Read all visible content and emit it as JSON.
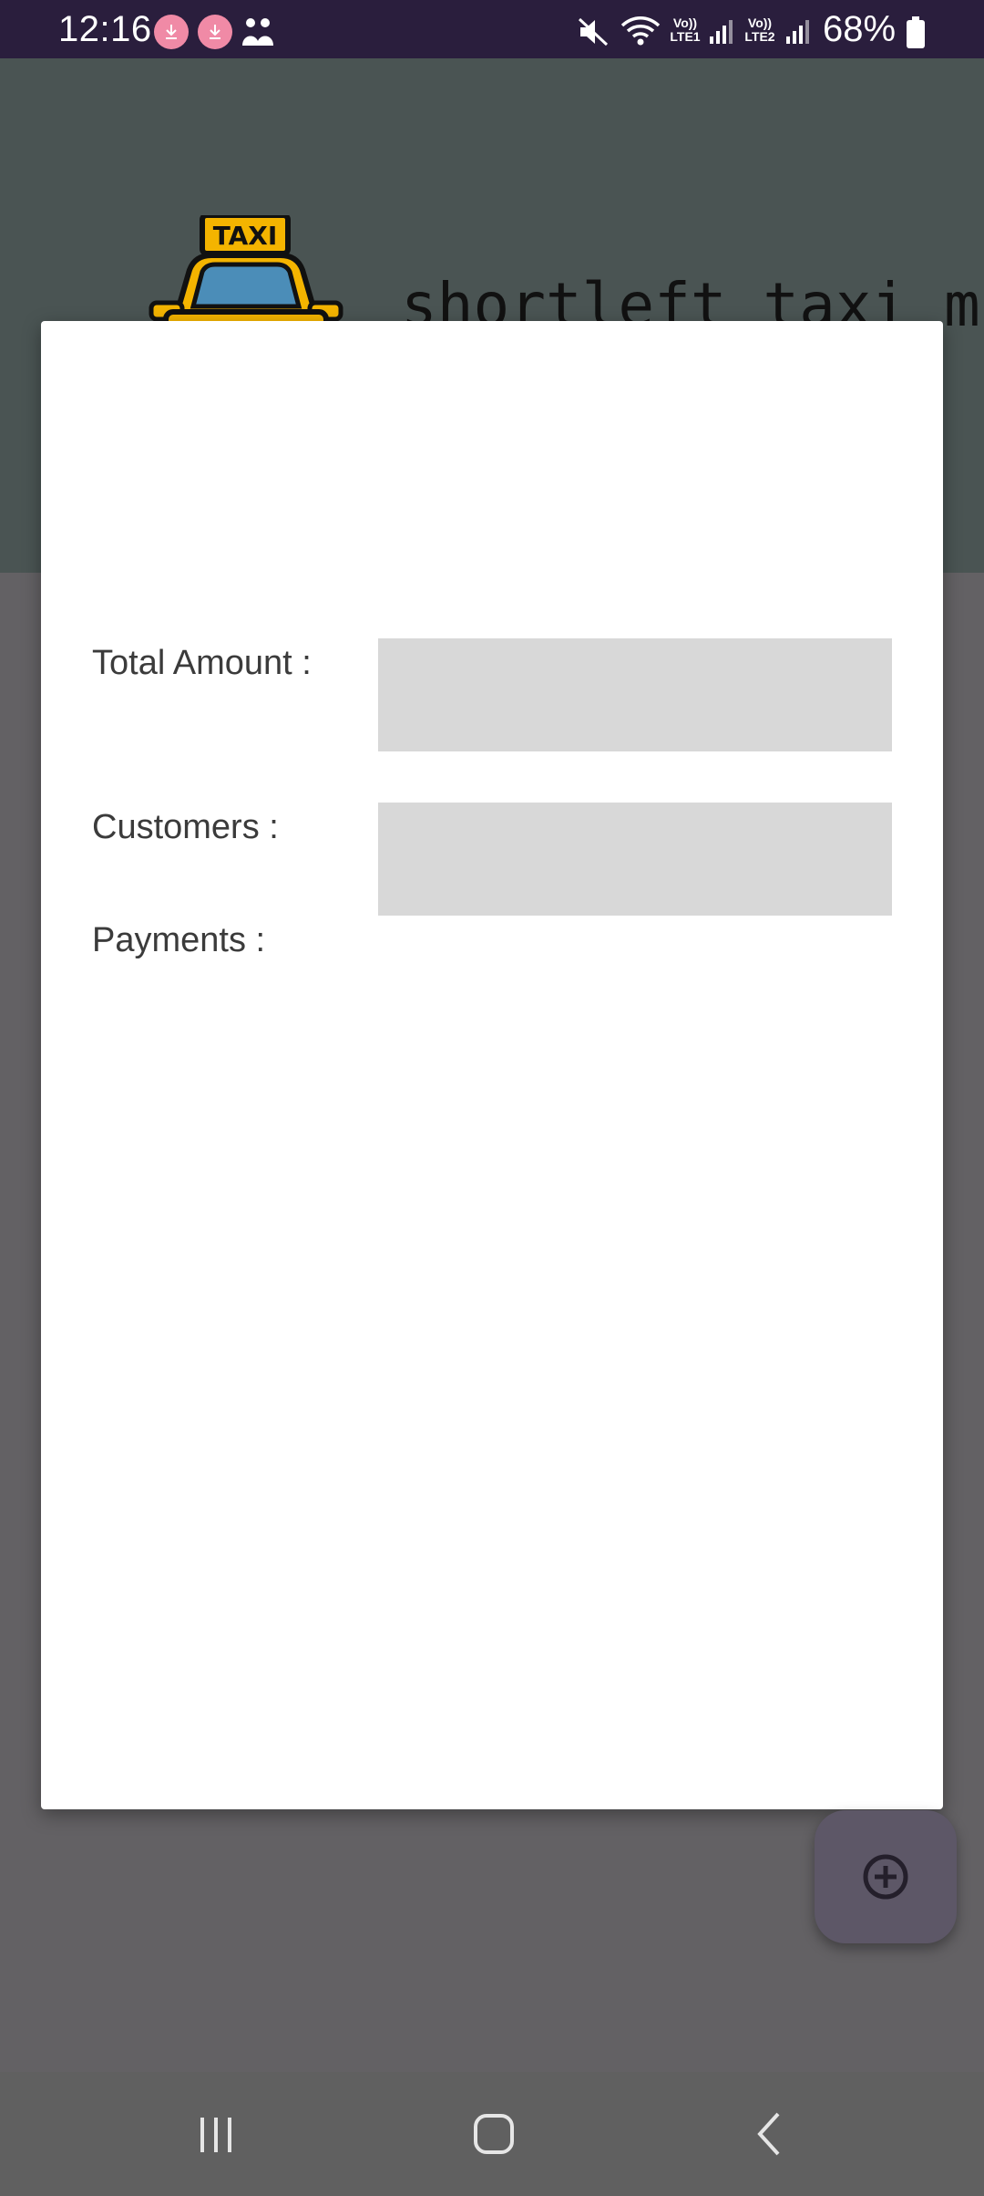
{
  "status_bar": {
    "time": "12:16",
    "battery_percent": "68%",
    "icons": [
      "download-notification-icon",
      "download-notification-icon",
      "family-icon",
      "mute-icon",
      "wifi-icon",
      "lte1-signal-icon",
      "lte2-signal-icon",
      "battery-icon"
    ],
    "network_labels": {
      "sim1_top": "Vo))",
      "sim1_bottom": "LTE1",
      "sim2_top": "Vo))",
      "sim2_bottom": "LTE2"
    }
  },
  "header": {
    "logo_text": "TAXI",
    "app_title": "shortleft taxi math"
  },
  "dialog": {
    "fields": [
      {
        "label": "Total Amount :",
        "value": ""
      },
      {
        "label": "Customers :",
        "value": ""
      },
      {
        "label": "Payments :"
      }
    ]
  },
  "fab": {
    "icon": "add-circle-icon"
  },
  "nav_bar": {
    "buttons": [
      "recent-apps-icon",
      "home-icon",
      "back-icon"
    ]
  },
  "colors": {
    "status_bar": "#2a1e3d",
    "header_band": "#4a5453",
    "scrim_background": "#636164",
    "dialog": "#ffffff",
    "input_box": "#d8d8d8",
    "fab": "#5d5767",
    "nav_bar": "#606060"
  }
}
